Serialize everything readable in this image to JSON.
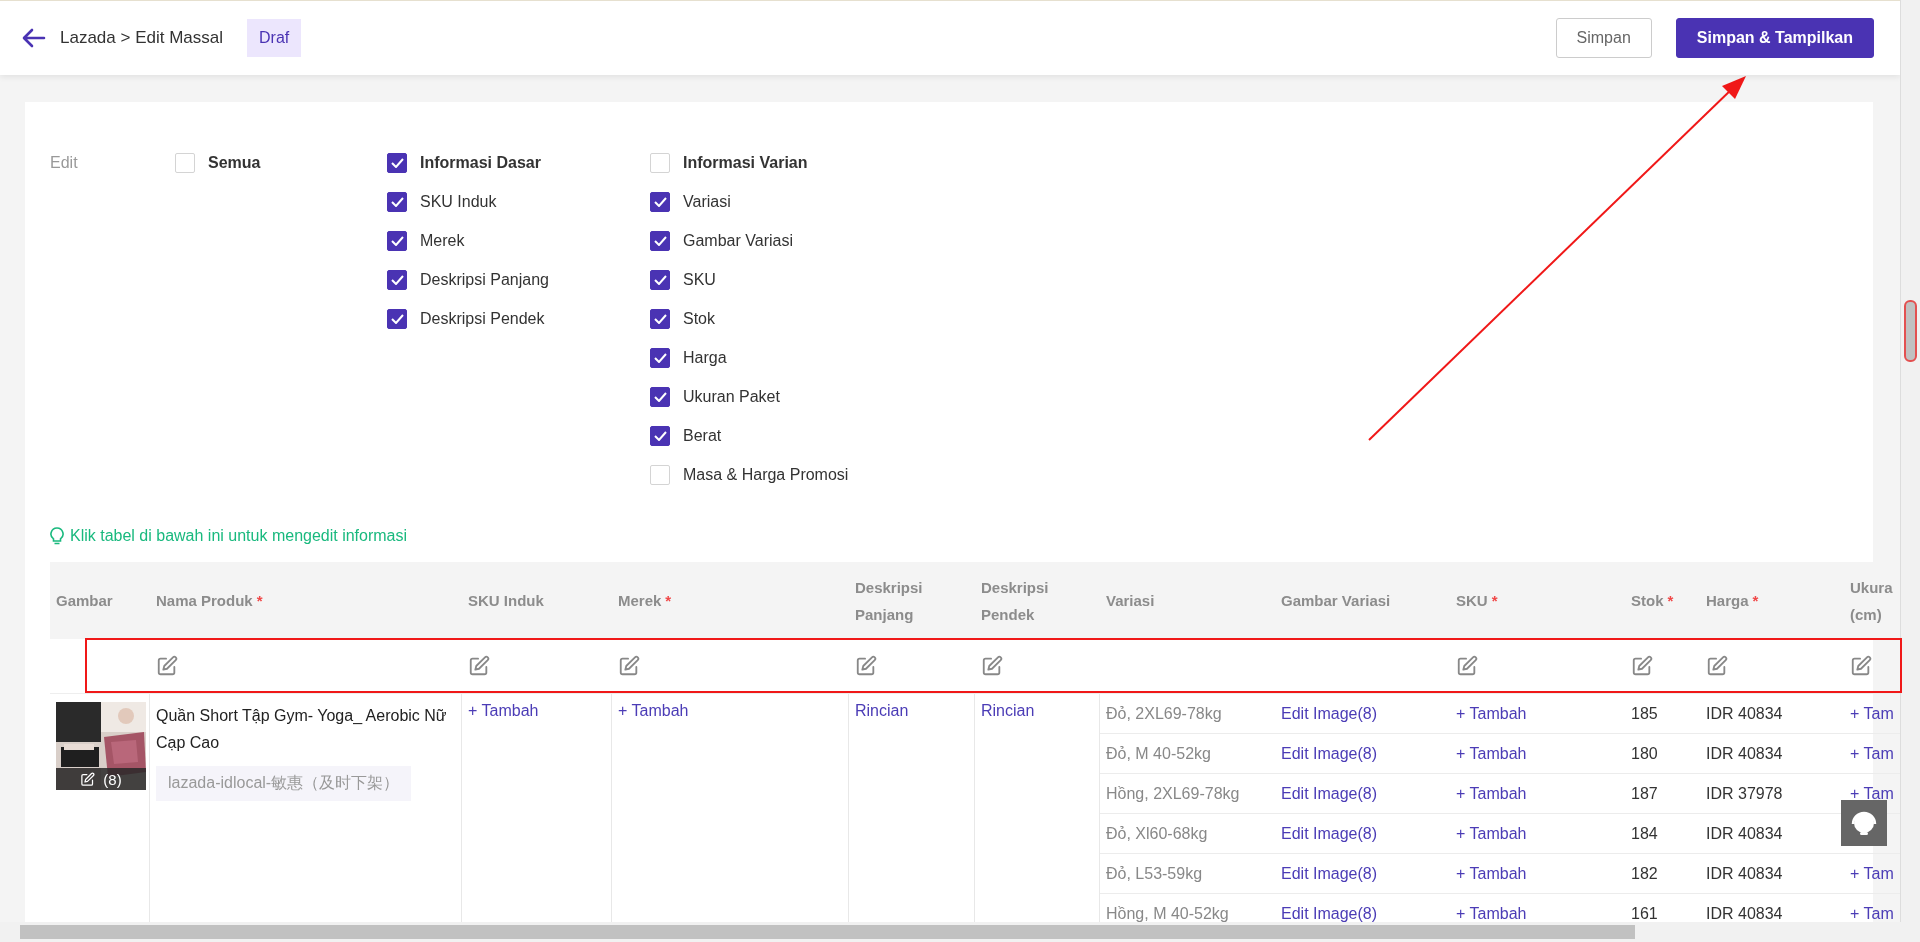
{
  "header": {
    "breadcrumb": "Lazada > Edit Massal",
    "status_badge": "Draf",
    "buttons": [
      {
        "label": "Simpan",
        "kind": "secondary"
      },
      {
        "label": "Simpan & Tampilkan",
        "kind": "primary"
      }
    ]
  },
  "edit_options": {
    "label": "Edit",
    "groups": [
      {
        "title": "Semua",
        "checked": false
      },
      {
        "title": "Informasi Dasar",
        "checked": true,
        "items": [
          {
            "label": "SKU Induk",
            "checked": true
          },
          {
            "label": "Merek",
            "checked": true
          },
          {
            "label": "Deskripsi Panjang",
            "checked": true
          },
          {
            "label": "Deskripsi Pendek",
            "checked": true
          }
        ]
      },
      {
        "title": "Informasi Varian",
        "checked": false,
        "items": [
          {
            "label": "Variasi",
            "checked": true
          },
          {
            "label": "Gambar Variasi",
            "checked": true
          },
          {
            "label": "SKU",
            "checked": true
          },
          {
            "label": "Stok",
            "checked": true
          },
          {
            "label": "Harga",
            "checked": true
          },
          {
            "label": "Ukuran Paket",
            "checked": true
          },
          {
            "label": "Berat",
            "checked": true
          },
          {
            "label": "Masa & Harga Promosi",
            "checked": false
          }
        ]
      }
    ]
  },
  "hint": "Klik tabel di bawah ini untuk mengedit informasi",
  "table": {
    "columns": [
      {
        "label": "Gambar",
        "bulk_edit": false
      },
      {
        "label": "Nama Produk",
        "required_mark": "*",
        "bulk_edit": true
      },
      {
        "label": "SKU Induk",
        "bulk_edit": true
      },
      {
        "label": "Merek",
        "required_mark": "*",
        "bulk_edit": true
      },
      {
        "label": "Deskripsi Panjang",
        "bulk_edit": true
      },
      {
        "label": "Deskripsi Pendek",
        "bulk_edit": true
      },
      {
        "label": "Variasi",
        "bulk_edit": false
      },
      {
        "label": "Gambar Variasi",
        "bulk_edit": false
      },
      {
        "label": "SKU",
        "required_mark": "*",
        "bulk_edit": true
      },
      {
        "label": "Stok",
        "required_mark": "*",
        "bulk_edit": true
      },
      {
        "label": "Harga",
        "required_mark": "*",
        "bulk_edit": true
      },
      {
        "label": "Ukura (cm)",
        "bulk_edit": true
      }
    ],
    "rows": [
      {
        "image": {
          "kind": "picture",
          "count": "(8)"
        },
        "name": "Quần Short Tập Gym- Yoga_ Aerobic Nữ Cạp Cao",
        "tag": "lazada-idlocal-敏惠（及时下架）",
        "sku_induk": "+ Tambah",
        "merek": "+ Tambah",
        "deskripsi_panjang": "Rincian",
        "deskripsi_pendek": "Rincian",
        "variants": [
          {
            "variasi": "Đỏ, 2XL69-78kg",
            "gambar_variasi": "Edit Image(8)",
            "sku": "+ Tambah",
            "stok": "185",
            "harga": "IDR 40834",
            "ukuran": "+ Tam"
          },
          {
            "variasi": "Đỏ, M 40-52kg",
            "gambar_variasi": "Edit Image(8)",
            "sku": "+ Tambah",
            "stok": "180",
            "harga": "IDR 40834",
            "ukuran": "+ Tam"
          },
          {
            "variasi": "Hồng, 2XL69-78kg",
            "gambar_variasi": "Edit Image(8)",
            "sku": "+ Tambah",
            "stok": "187",
            "harga": "IDR 37978",
            "ukuran": "+ Tam"
          },
          {
            "variasi": "Đỏ, Xl60-68kg",
            "gambar_variasi": "Edit Image(8)",
            "sku": "+ Tambah",
            "stok": "184",
            "harga": "IDR 40834"
          },
          {
            "variasi": "Đỏ, L53-59kg",
            "gambar_variasi": "Edit Image(8)",
            "sku": "+ Tambah",
            "stok": "182",
            "harga": "IDR 40834",
            "ukuran": "+ Tam"
          },
          {
            "variasi": "Hồng, M 40-52kg",
            "gambar_variasi": "Edit Image(8)",
            "sku": "+ Tambah",
            "stok": "161",
            "harga": "IDR 40834",
            "ukuran": "+ Tam"
          }
        ]
      }
    ]
  }
}
